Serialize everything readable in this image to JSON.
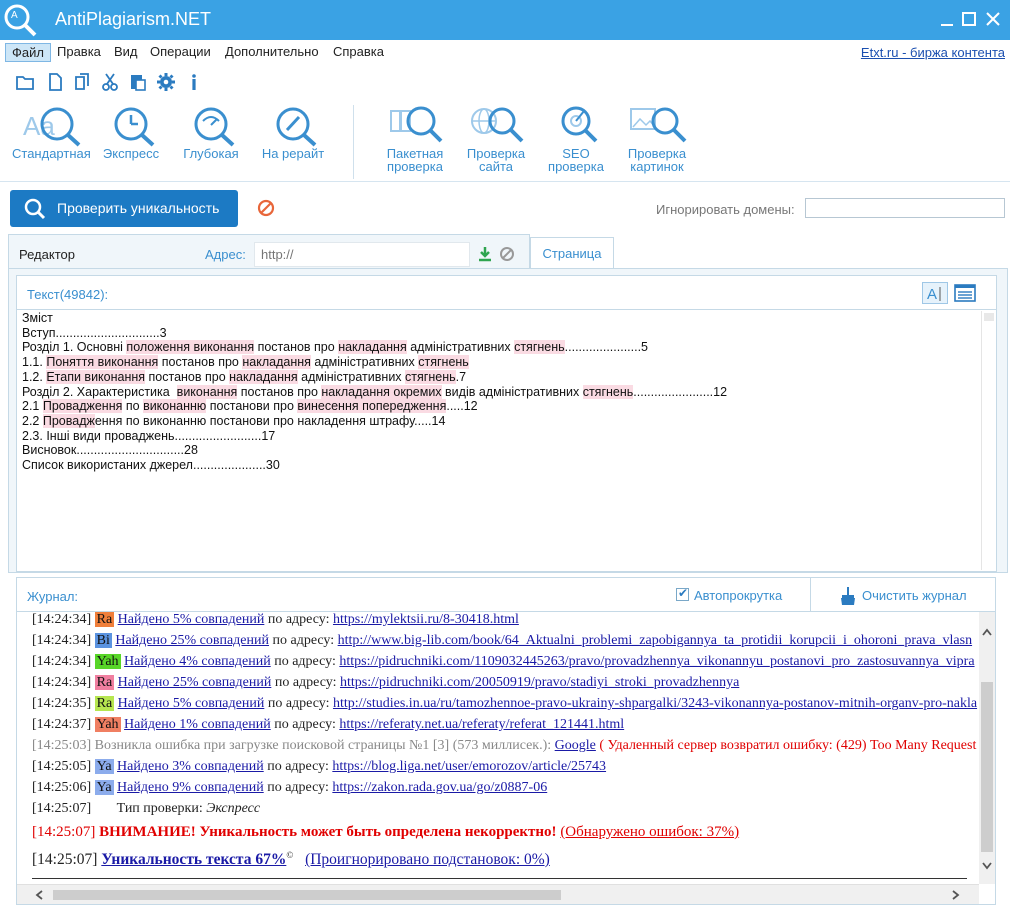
{
  "app": {
    "title": "AntiPlagiarism.NET"
  },
  "menu": {
    "items": [
      "Файл",
      "Правка",
      "Вид",
      "Операции",
      "Дополнительно",
      "Справка"
    ],
    "etxt_link": "Etxt.ru - биржа контента"
  },
  "toolbar": {
    "buttons": [
      {
        "label": "Стандартная"
      },
      {
        "label": "Экспресс"
      },
      {
        "label": "Глубокая"
      },
      {
        "label": "На рерайт"
      },
      {
        "label1": "Пакетная",
        "label2": "проверка"
      },
      {
        "label1": "Проверка",
        "label2": "сайта"
      },
      {
        "label1": "SEO",
        "label2": "проверка"
      },
      {
        "label1": "Проверка",
        "label2": "картинок"
      }
    ]
  },
  "check": {
    "button_label": "Проверить уникальность",
    "ignore_label": "Игнорировать домены:",
    "ignore_value": ""
  },
  "editor": {
    "tab_label": "Редактор",
    "address_label": "Адрес:",
    "address_placeholder": "http://",
    "page_tab": "Страница",
    "text_count": "Текст(49842):"
  },
  "journal": {
    "label": "Журнал:",
    "autoscroll_label": "Автопрокрутка",
    "autoscroll_checked": true,
    "clear_label": "Очистить журнал",
    "rows": [
      {
        "time": "[14:24:34]",
        "badge": "Ra",
        "found": "Найдено 5% совпадений",
        "at": "по адресу:",
        "url": "https://mylektsii.ru/8-30418.html"
      },
      {
        "time": "[14:24:34]",
        "badge": "Bi",
        "found": "Найдено 25% совпадений",
        "at": "по адресу:",
        "url": "http://www.big-lib.com/book/64_Aktualni_problemi_zapobigannya_ta_protidii_korupcii_i_ohoroni_prava_vlasn"
      },
      {
        "time": "[14:24:34]",
        "badge": "Yah",
        "found": "Найдено 4% совпадений",
        "at": "по адресу:",
        "url": "https://pidruchniki.com/1109032445263/pravo/provadzhennya_vikonannyu_postanovi_pro_zastosuvannya_vipra"
      },
      {
        "time": "[14:24:34]",
        "badge": "Ra",
        "found": "Найдено 25% совпадений",
        "at": "по адресу:",
        "url": "https://pidruchniki.com/20050919/pravo/stadiyi_stroki_provadzhennya"
      },
      {
        "time": "[14:24:35]",
        "badge": "Ra",
        "found": "Найдено 5% совпадений",
        "at": "по адресу:",
        "url": "http://studies.in.ua/ru/tamozhennoe-pravo-ukrainy-shpargalki/3243-vikonannya-postanov-mitnih-organv-pro-nakla"
      },
      {
        "time": "[14:24:37]",
        "badge": "Yah",
        "found": "Найдено 1% совпадений",
        "at": "по адресу:",
        "url": "https://referaty.net.ua/referaty/referat_121441.html"
      },
      {
        "time": "[14:25:03]",
        "error_text": "Возникла ошибка при загрузке поисковой страницы №1 [3] (573 миллисек.):",
        "engine": "Google",
        "error_detail": "( Удаленный сервер возвратил ошибку: (429) Too Many Request"
      },
      {
        "time": "[14:25:05]",
        "badge": "Ya",
        "found": "Найдено 3% совпадений",
        "at": "по адресу:",
        "url": "https://blog.liga.net/user/emorozov/article/25743"
      },
      {
        "time": "[14:25:06]",
        "badge": "Ya",
        "found": "Найдено 9% совпадений",
        "at": "по адресу:",
        "url": "https://zakon.rada.gov.ua/go/z0887-06"
      },
      {
        "time": "[14:25:07]",
        "type_label": "Тип проверки:",
        "type_value": "Экспресс"
      }
    ],
    "warning": {
      "time": "[14:25:07]",
      "text": "ВНИМАНИЕ! Уникальность может быть определена некорректно!",
      "detail": "(Обнаружено ошибок: 37%)"
    },
    "result": {
      "time": "[14:25:07]",
      "text": "Уникальность текста 67%",
      "sup": "©",
      "detail": "(Проигнорировано подстановок: 0%)"
    }
  },
  "colors": {
    "accent": "#3aa2e4",
    "primary_button": "#1c7ac4",
    "highlight": "#fadbe3"
  }
}
